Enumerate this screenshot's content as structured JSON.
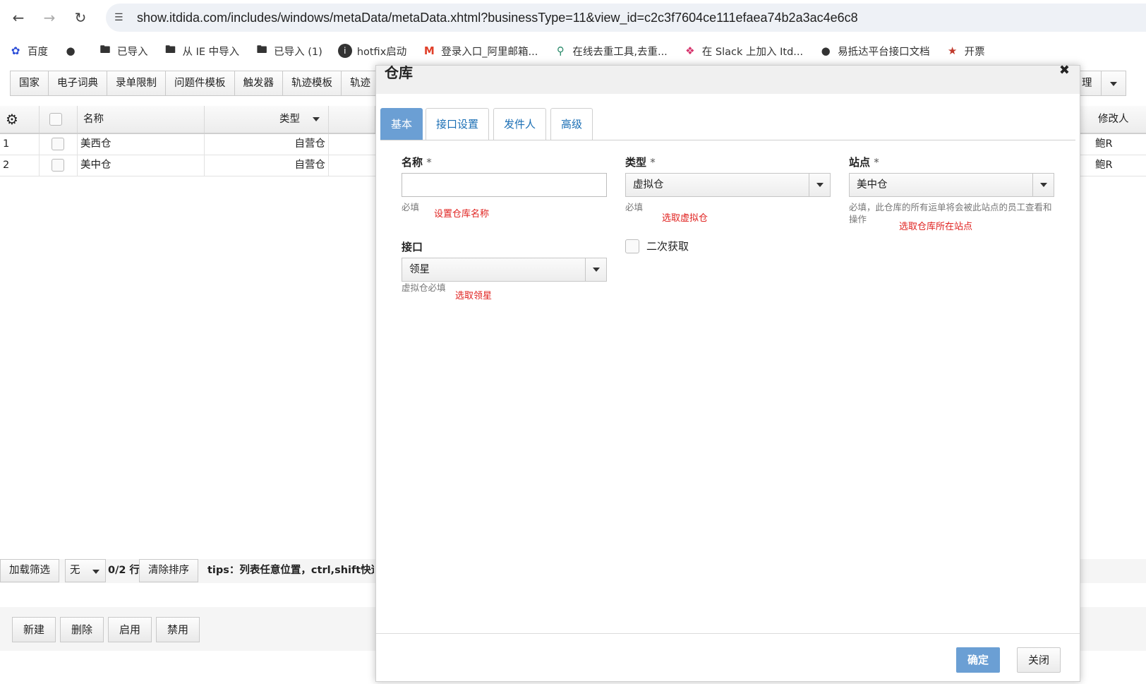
{
  "browser": {
    "url": "show.itdida.com/includes/windows/metaData/metaData.xhtml?businessType=11&view_id=c2c3f7604ce111efaea74b2a3ac4e6c8",
    "bookmarks": [
      {
        "label": "百度",
        "icon": "baidu-paw-icon"
      },
      {
        "label": "",
        "icon": "globe-icon"
      },
      {
        "label": "已导入",
        "icon": "folder-icon"
      },
      {
        "label": "从 IE 中导入",
        "icon": "folder-icon"
      },
      {
        "label": "已导入 (1)",
        "icon": "folder-icon"
      },
      {
        "label": "hotfix启动",
        "icon": "info-icon"
      },
      {
        "label": "登录入口_阿里邮箱...",
        "icon": "mail-icon"
      },
      {
        "label": "在线去重工具,去重...",
        "icon": "search-icon"
      },
      {
        "label": "在 Slack 上加入 Itd...",
        "icon": "slack-icon"
      },
      {
        "label": "易抵达平台接口文档",
        "icon": "globe-icon"
      },
      {
        "label": "开票",
        "icon": "tax-icon"
      }
    ]
  },
  "toolbar": {
    "items": [
      "国家",
      "电子词典",
      "录单限制",
      "问题件模板",
      "触发器",
      "轨迹模板",
      "轨迹"
    ],
    "right_label": "理"
  },
  "grid": {
    "headers": {
      "name": "名称",
      "type": "类型",
      "modifier": "修改人"
    },
    "rows": [
      {
        "index": "1",
        "name": "美西仓",
        "type": "自营仓",
        "modifier": "鲍R"
      },
      {
        "index": "2",
        "name": "美中仓",
        "type": "自营仓",
        "modifier": "鲍R"
      }
    ]
  },
  "filter": {
    "load_filter": "加载筛选",
    "none": "无",
    "row_count": "0/2 行",
    "clear_sort": "清除排序",
    "tips": "tips：列表任意位置，ctrl,shift快速"
  },
  "actions": {
    "new": "新建",
    "delete": "删除",
    "enable": "启用",
    "disable": "禁用"
  },
  "modal": {
    "title": "仓库",
    "tabs": [
      "基本",
      "接口设置",
      "发件人",
      "高级"
    ],
    "fields": {
      "name": {
        "label": "名称",
        "req": "*",
        "value": "",
        "hint": "必填",
        "annotation": "设置仓库名称"
      },
      "type": {
        "label": "类型",
        "req": "*",
        "value": "虚拟仓",
        "hint": "必填",
        "annotation": "选取虚拟仓"
      },
      "site": {
        "label": "站点",
        "req": "*",
        "value": "美中仓",
        "hint": "必填，此仓库的所有运单将会被此站点的员工查看和操作",
        "annotation": "选取仓库所在站点"
      },
      "interface": {
        "label": "接口",
        "value": "领星",
        "hint": "虚拟仓必填",
        "annotation": "选取领星"
      },
      "second_fetch": {
        "label": "二次获取",
        "checked": false
      }
    },
    "ok": "确定",
    "close": "关闭"
  }
}
